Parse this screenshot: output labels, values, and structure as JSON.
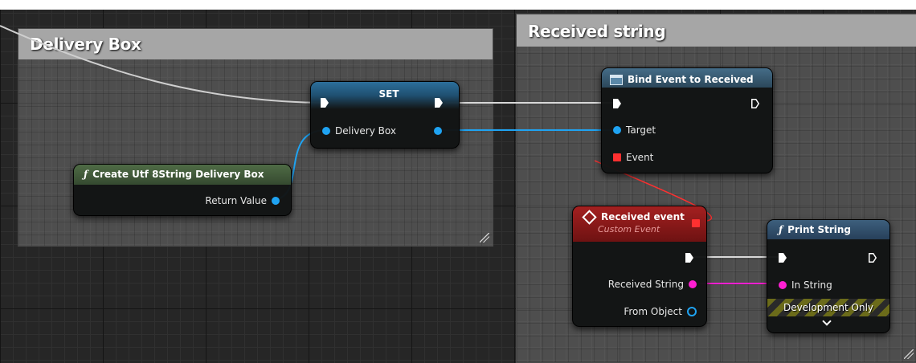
{
  "colors": {
    "exec_wire": "#d8d8d8",
    "object_wire": "#1fa3f2",
    "string_wire": "#ff1fd2",
    "delegate_wire": "#ff3030",
    "function_header": "#4f6b45",
    "event_header": "#8f1a1a",
    "set_header": "#2c6f9b",
    "bind_header": "#35586f"
  },
  "comments": {
    "delivery_box": {
      "title": "Delivery Box"
    },
    "received_string": {
      "title": "Received string"
    }
  },
  "nodes": {
    "set": {
      "title": "SET",
      "pin_delivery_box": "Delivery Box"
    },
    "create_utf": {
      "title": "Create Utf 8String Delivery Box",
      "icon": "function-icon",
      "pin_return_value": "Return Value"
    },
    "bind_event": {
      "title": "Bind Event to Received",
      "icon": "event-dispatcher-icon",
      "pin_target": "Target",
      "pin_event": "Event"
    },
    "received_event": {
      "title": "Received event",
      "subtitle": "Custom Event",
      "icon": "custom-event-icon",
      "pin_received_string": "Received String",
      "pin_from_object": "From Object"
    },
    "print_string": {
      "title": "Print String",
      "icon": "function-icon",
      "pin_in_string": "In String",
      "dev_only": "Development Only"
    }
  }
}
